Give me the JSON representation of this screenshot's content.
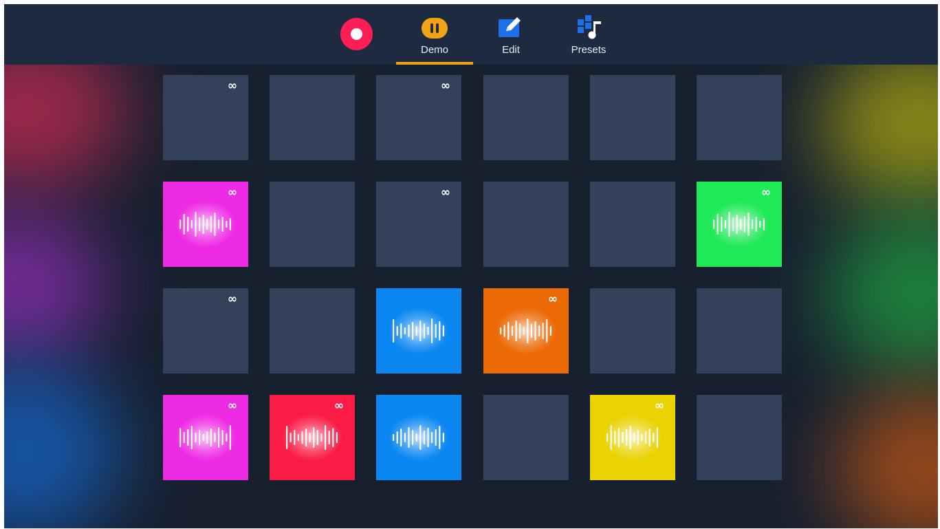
{
  "colors": {
    "background": "#17202f",
    "topbar": "#1e2a40",
    "pad_empty": "#33415a",
    "record": "#fe1d55",
    "accent": "#f2a214",
    "magenta": "#ee2be4",
    "green": "#1ee956",
    "blue": "#0a87f1",
    "orange": "#ec6a06",
    "red": "#fa1c46",
    "yellow": "#ead203"
  },
  "toolbar": {
    "record_button": {
      "icon": "record-icon"
    },
    "tabs": [
      {
        "id": "demo",
        "label": "Demo",
        "icon": "pause-icon",
        "active": true
      },
      {
        "id": "edit",
        "label": "Edit",
        "icon": "pencil-icon",
        "active": false
      },
      {
        "id": "presets",
        "label": "Presets",
        "icon": "presets-icon",
        "active": false
      }
    ]
  },
  "pads": {
    "loop_symbol": "∞",
    "items": [
      {
        "color": "empty",
        "loop": true,
        "playing": false
      },
      {
        "color": "empty",
        "loop": false,
        "playing": false
      },
      {
        "color": "empty",
        "loop": true,
        "playing": false
      },
      {
        "color": "empty",
        "loop": false,
        "playing": false
      },
      {
        "color": "empty",
        "loop": false,
        "playing": false
      },
      {
        "color": "empty",
        "loop": false,
        "playing": false
      },
      {
        "color": "magenta",
        "loop": true,
        "playing": true
      },
      {
        "color": "empty",
        "loop": false,
        "playing": false
      },
      {
        "color": "empty",
        "loop": true,
        "playing": false
      },
      {
        "color": "empty",
        "loop": false,
        "playing": false
      },
      {
        "color": "empty",
        "loop": false,
        "playing": false
      },
      {
        "color": "green",
        "loop": true,
        "playing": true
      },
      {
        "color": "empty",
        "loop": true,
        "playing": false
      },
      {
        "color": "empty",
        "loop": false,
        "playing": false
      },
      {
        "color": "blue",
        "loop": false,
        "playing": true
      },
      {
        "color": "orange",
        "loop": true,
        "playing": true
      },
      {
        "color": "empty",
        "loop": false,
        "playing": false
      },
      {
        "color": "empty",
        "loop": false,
        "playing": false
      },
      {
        "color": "magenta",
        "loop": true,
        "playing": true
      },
      {
        "color": "red",
        "loop": true,
        "playing": true
      },
      {
        "color": "blue",
        "loop": false,
        "playing": true
      },
      {
        "color": "empty",
        "loop": false,
        "playing": false
      },
      {
        "color": "yellow",
        "loop": true,
        "playing": true
      },
      {
        "color": "empty",
        "loop": false,
        "playing": false
      }
    ]
  }
}
